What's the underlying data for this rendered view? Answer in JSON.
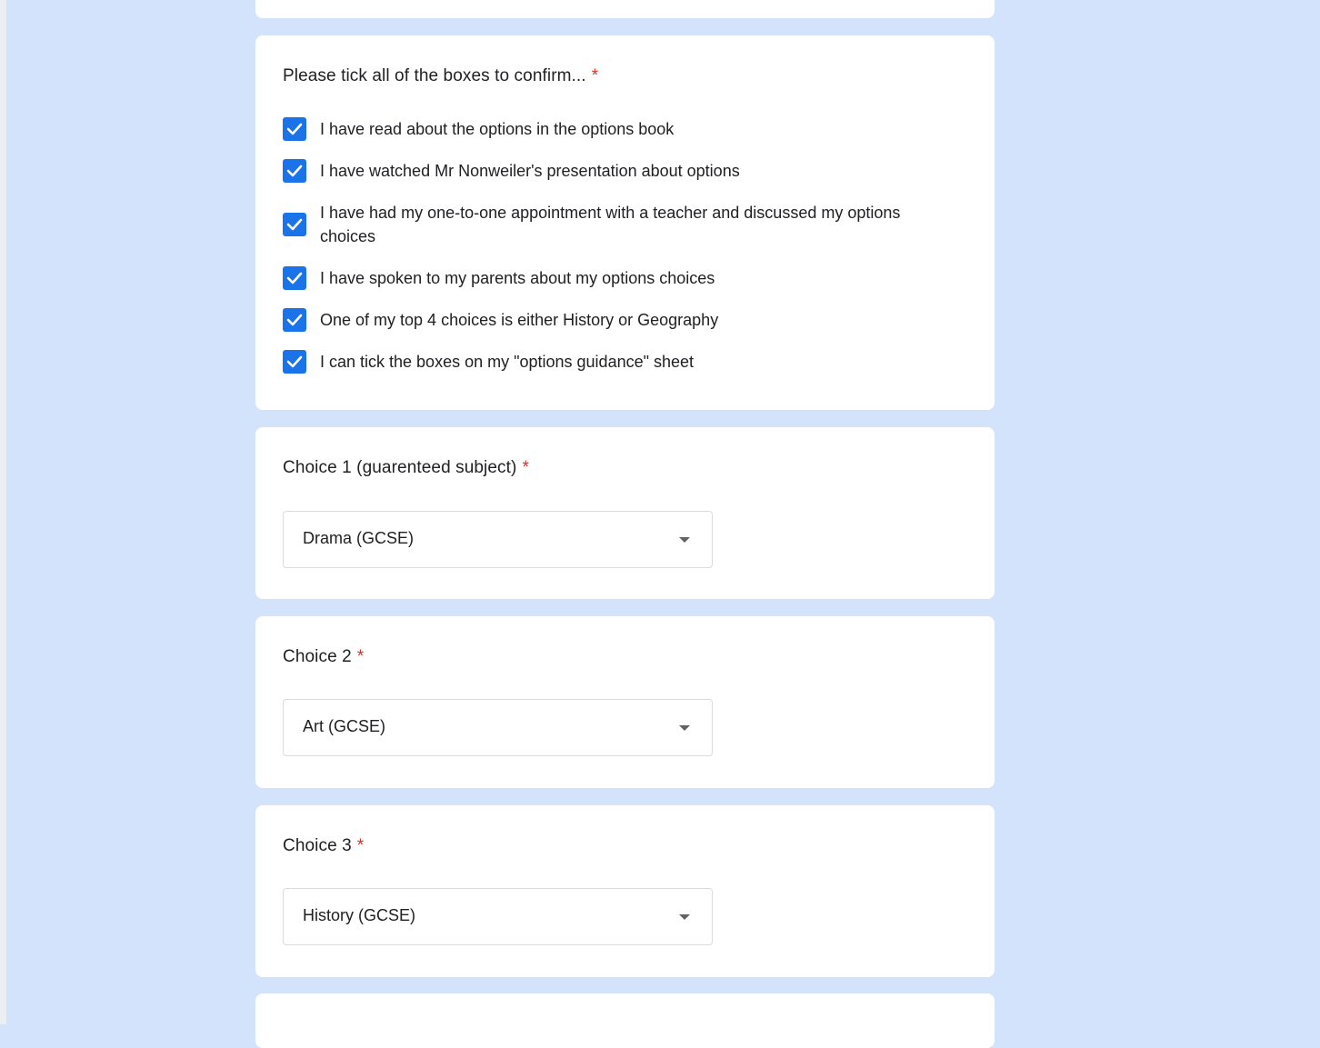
{
  "confirm_question": {
    "title": "Please tick all of the boxes to confirm...",
    "required_marker": "*",
    "options": [
      {
        "label": "I have read about the options in the options book",
        "checked": true
      },
      {
        "label": "I have watched Mr Nonweiler's presentation about options",
        "checked": true
      },
      {
        "label": "I have had my one-to-one appointment with a teacher and discussed my options choices",
        "checked": true
      },
      {
        "label": "I have spoken to my parents about my options choices",
        "checked": true
      },
      {
        "label": "One of my top 4 choices is either History or Geography",
        "checked": true
      },
      {
        "label": "I can tick the boxes on my \"options guidance\" sheet",
        "checked": true
      }
    ]
  },
  "choice_questions": [
    {
      "title": "Choice 1 (guarenteed subject)",
      "required_marker": "*",
      "selected": "Drama (GCSE)"
    },
    {
      "title": "Choice 2",
      "required_marker": "*",
      "selected": "Art (GCSE)"
    },
    {
      "title": "Choice 3",
      "required_marker": "*",
      "selected": "History (GCSE)"
    }
  ],
  "colors": {
    "page_background": "#d3e3fc",
    "checkbox_checked": "#1a73e8",
    "required_marker": "#d93025"
  },
  "icons": {
    "checkbox": "checkmark-icon",
    "dropdown": "dropdown-arrow-icon"
  }
}
